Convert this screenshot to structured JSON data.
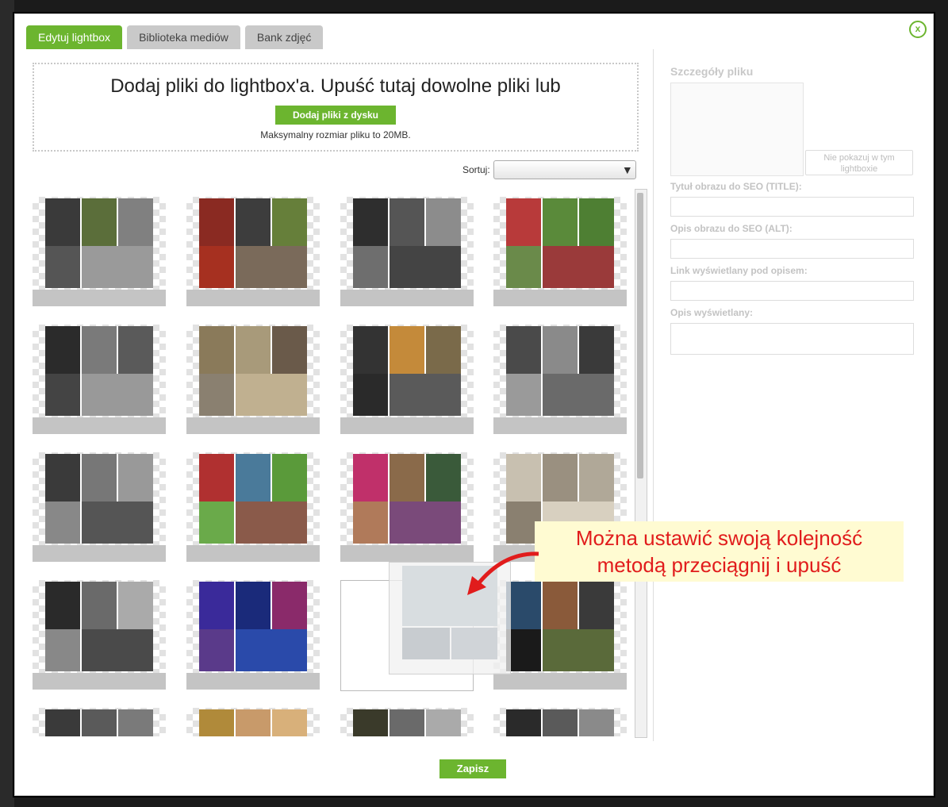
{
  "tabs": [
    {
      "label": "Edytuj lightbox",
      "active": true
    },
    {
      "label": "Biblioteka mediów",
      "active": false
    },
    {
      "label": "Bank zdjęć",
      "active": false
    }
  ],
  "close_label": "x",
  "dropzone": {
    "title": "Dodaj pliki do lightbox'a. Upuść tutaj dowolne pliki lub",
    "button": "Dodaj pliki z dysku",
    "hint": "Maksymalny rozmiar pliku to 20MB."
  },
  "sort": {
    "label": "Sortuj:",
    "value": ""
  },
  "details": {
    "title": "Szczegóły pliku",
    "hide_button": "Nie pokazuj w tym lightboxie",
    "fields": [
      {
        "label": "Tytuł obrazu do SEO (TITLE):",
        "value": ""
      },
      {
        "label": "Opis obrazu do SEO (ALT):",
        "value": ""
      },
      {
        "label": "Link wyświetlany pod opisem:",
        "value": ""
      },
      {
        "label": "Opis wyświetlany:",
        "value": ""
      }
    ]
  },
  "callout": {
    "line1": "Można ustawić swoją kolejność",
    "line2": "metodą przeciągnij i upuść"
  },
  "save_label": "Zapisz",
  "colors": {
    "accent": "#6cb52f",
    "callout_text": "#e11c1c",
    "callout_bg": "#fffbd2"
  },
  "tiles": [
    {
      "colors": [
        "#3a3a3a",
        "#5b6e3a",
        "#808080",
        "#9a9a9a",
        "#555555"
      ]
    },
    {
      "colors": [
        "#8a2a22",
        "#3d3d3d",
        "#667f3a",
        "#7a6a5a",
        "#a63020"
      ]
    },
    {
      "colors": [
        "#2e2e2e",
        "#555555",
        "#8c8c8c",
        "#444444",
        "#6e6e6e"
      ]
    },
    {
      "colors": [
        "#b83a3a",
        "#5a8a3a",
        "#4e7f33",
        "#9a3a3a",
        "#6a8a4a"
      ]
    },
    {
      "colors": [
        "#2b2b2b",
        "#7a7a7a",
        "#5a5a5a",
        "#999999",
        "#444444"
      ]
    },
    {
      "colors": [
        "#8a7a5a",
        "#a89a7a",
        "#6a5a4a",
        "#c0b090",
        "#8a8070"
      ]
    },
    {
      "colors": [
        "#333333",
        "#c48a3a",
        "#7a6a4a",
        "#5a5a5a",
        "#2a2a2a"
      ]
    },
    {
      "colors": [
        "#4a4a4a",
        "#8a8a8a",
        "#3a3a3a",
        "#6a6a6a",
        "#9a9a9a"
      ]
    },
    {
      "colors": [
        "#3a3a3a",
        "#777777",
        "#999999",
        "#555555",
        "#888888"
      ]
    },
    {
      "colors": [
        "#b03030",
        "#4a7a9a",
        "#5a9a3a",
        "#8a5a4a",
        "#6aaa4a"
      ]
    },
    {
      "colors": [
        "#c0306a",
        "#8a6a4a",
        "#3a5a3a",
        "#7a4a7a",
        "#b07a5a"
      ]
    },
    {
      "colors": [
        "#c8c0b0",
        "#9a9080",
        "#b0a898",
        "#d8d0c0",
        "#8a8070"
      ]
    },
    {
      "colors": [
        "#2a2a2a",
        "#6a6a6a",
        "#aaaaaa",
        "#4a4a4a",
        "#888888"
      ]
    },
    {
      "colors": [
        "#3a2a9a",
        "#1a2a7a",
        "#8a2a6a",
        "#2a4aaa",
        "#5a3a8a"
      ]
    },
    {
      "colors": [],
      "placeholder": true
    },
    {
      "colors": [
        "#2a4a6a",
        "#8a5a3a",
        "#3a3a3a",
        "#5a6a3a",
        "#1a1a1a"
      ]
    },
    {
      "colors": [
        "#3a3a3a",
        "#5a5a5a",
        "#7a7a7a",
        "#4a4a4a",
        "#6a6a6a"
      ]
    },
    {
      "colors": [
        "#b08a3a",
        "#c89a6a",
        "#d8b07a",
        "#e0a880",
        "#a07a4a"
      ]
    },
    {
      "colors": [
        "#3a3a2a",
        "#6a6a6a",
        "#aaaaaa",
        "#555555",
        "#777777"
      ]
    },
    {
      "colors": [
        "#2a2a2a",
        "#5a5a5a",
        "#8a8a8a",
        "#444444",
        "#666666"
      ]
    }
  ]
}
